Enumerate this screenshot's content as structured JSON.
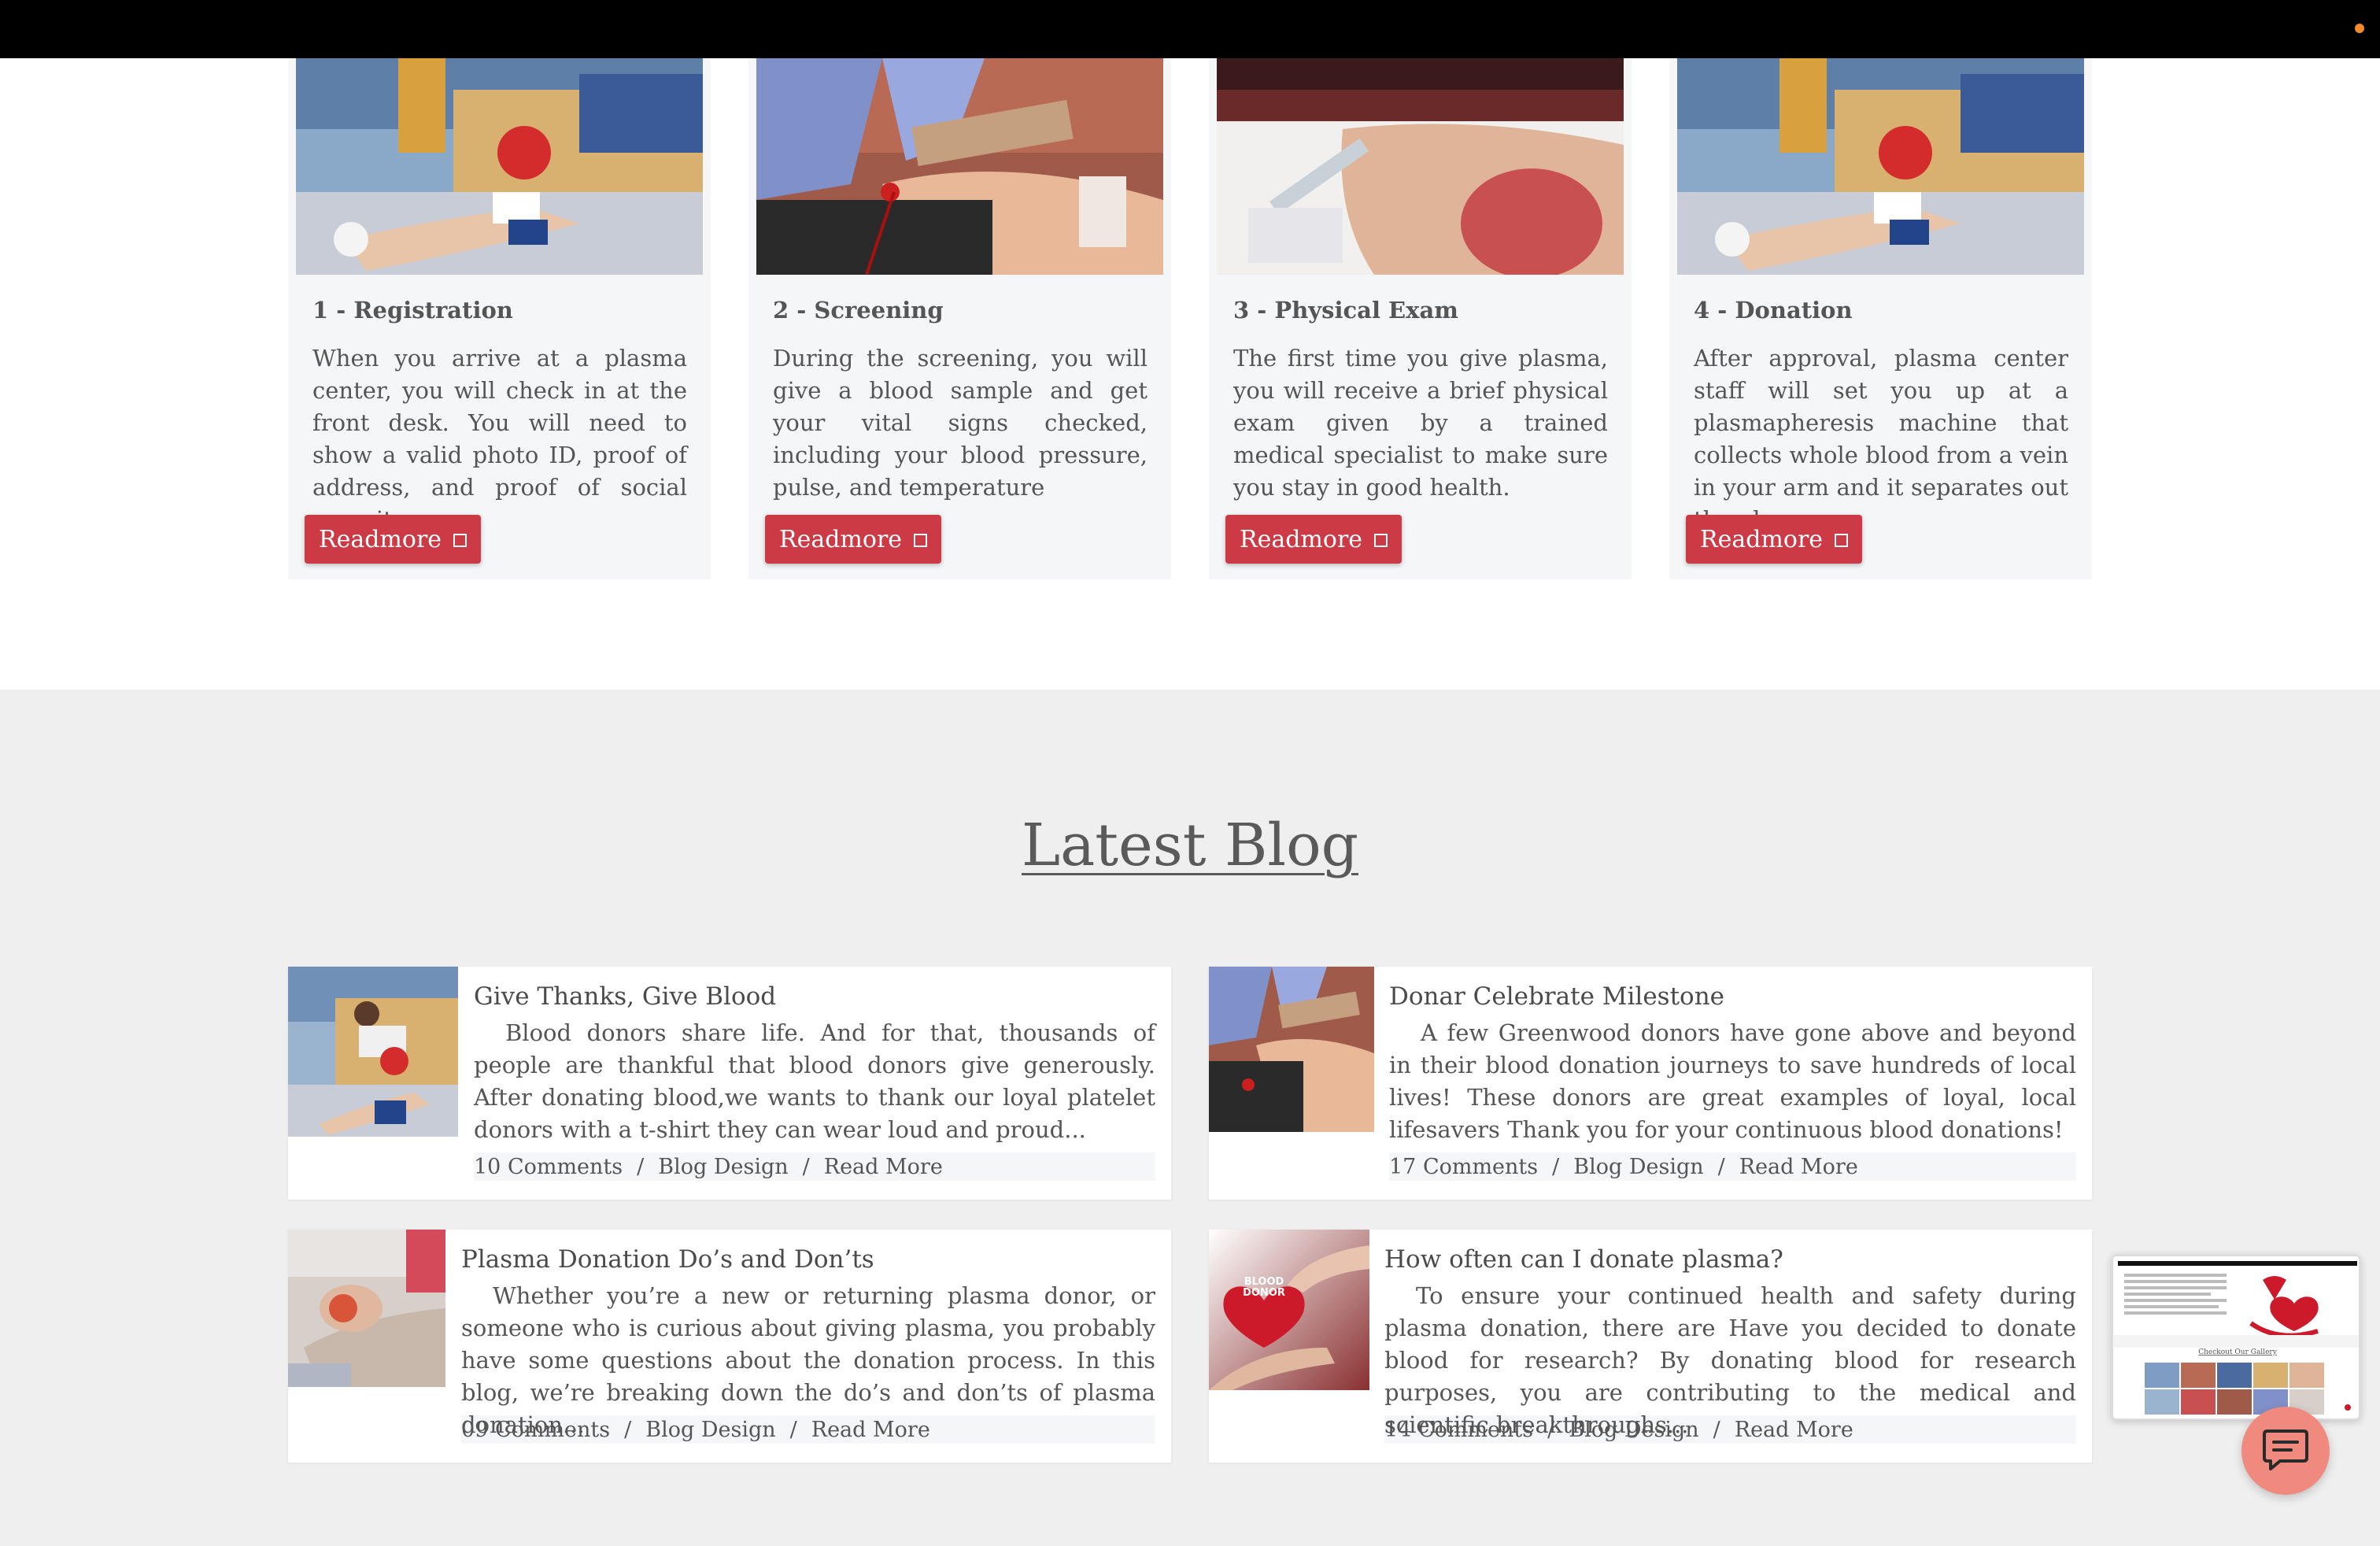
{
  "colors": {
    "topbar": "#000000",
    "accent_red": "#cc3a45",
    "card_bg": "#f5f6f8",
    "blog_section_bg": "#efefef",
    "chat_button": "#f08a7e",
    "notification_dot": "#f28c28"
  },
  "steps": [
    {
      "title": "1 - Registration",
      "text": "When you arrive at a plasma center, you will check in at the front desk. You will need to show a valid photo ID, proof of address, and proof of social security.",
      "button": "Readmore",
      "image": "blood-donation-chair-photo"
    },
    {
      "title": "2 - Screening",
      "text": "During the screening, you will give a blood sample and get your vital signs checked, including your blood pressure, pulse, and temperature",
      "button": "Readmore",
      "image": "gloved-hands-blood-bag-photo"
    },
    {
      "title": "3 - Physical Exam",
      "text": "The first time you give plasma, you will receive a brief physical exam given by a trained medical specialist to make sure you stay in good health.",
      "button": "Readmore",
      "image": "hand-squeezing-ball-photo"
    },
    {
      "title": "4 - Donation",
      "text": "After approval, plasma center staff will set you up at a plasmapheresis machine that collects whole blood from a vein in your arm and it separates out the plasma.",
      "button": "Readmore",
      "image": "blood-donation-chair-photo"
    }
  ],
  "blog": {
    "heading": "Latest Blog",
    "posts": [
      {
        "title": "Give Thanks, Give Blood",
        "excerpt": "Blood donors share life. And for that, thousands of people are thankful that blood donors give generously. After donating blood,we wants to thank our loyal platelet donors with a t-shirt they can wear loud and proud...",
        "comments": "10 Comments",
        "category": "Blog Design",
        "read_more": "Read More",
        "image": "donor-in-chair-photo"
      },
      {
        "title": "Donar Celebrate Milestone",
        "excerpt": "A few Greenwood donors have gone above and beyond in their blood donation journeys to save hundreds of local lives! These donors are great examples of loyal, local lifesavers Thank you for your continuous blood donations!",
        "comments": "17 Comments",
        "category": "Blog Design",
        "read_more": "Read More",
        "image": "gloved-hands-blood-bag-photo"
      },
      {
        "title": "Plasma Donation Do’s and Don’ts",
        "excerpt": "Whether you’re a new or returning plasma donor, or someone who is curious about giving plasma, you probably have some questions about the donation process. In this blog, we’re breaking down the do’s and don’ts of plasma donation...",
        "comments": "09 Comments",
        "category": "Blog Design",
        "read_more": "Read More",
        "image": "hand-squeezing-ball-photo"
      },
      {
        "title": "How often can I donate plasma?",
        "excerpt": "To ensure your continued health and safety during plasma donation, there are Have you decided to donate blood for research? By donating blood for research purposes, you are contributing to the medical and scientific breakthroughs...",
        "comments": "14 Comments",
        "category": "Blog Design",
        "read_more": "Read More",
        "image": "blood-donor-heart-hands-photo",
        "image_text": "BLOOD DONOR"
      }
    ]
  },
  "preview": {
    "caption": "Checkout Our Gallery"
  },
  "chat": {
    "icon": "chat-bubble-icon"
  }
}
